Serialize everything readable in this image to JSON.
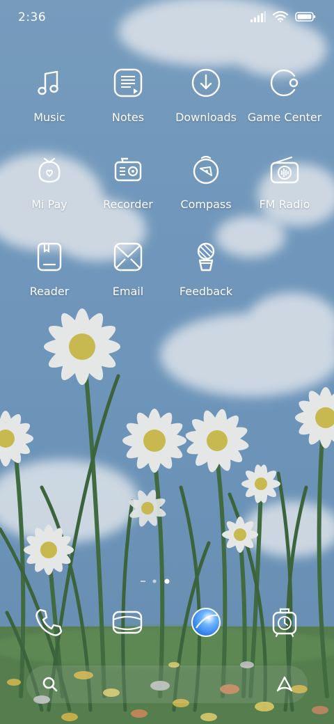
{
  "status_bar": {
    "time": "2:36"
  },
  "apps": [
    {
      "label": "Music",
      "icon": "music-icon"
    },
    {
      "label": "Notes",
      "icon": "notes-icon"
    },
    {
      "label": "Downloads",
      "icon": "downloads-icon"
    },
    {
      "label": "Game Center",
      "icon": "game-center-icon"
    },
    {
      "label": "Mi Pay",
      "icon": "mi-pay-icon"
    },
    {
      "label": "Recorder",
      "icon": "recorder-icon"
    },
    {
      "label": "Compass",
      "icon": "compass-icon"
    },
    {
      "label": "FM Radio",
      "icon": "fm-radio-icon"
    },
    {
      "label": "Reader",
      "icon": "reader-icon"
    },
    {
      "label": "Email",
      "icon": "email-icon"
    },
    {
      "label": "Feedback",
      "icon": "feedback-icon"
    }
  ],
  "page_indicator": {
    "pages": 3,
    "current": 3
  },
  "dock": [
    "phone-icon",
    "messages-icon",
    "browser-icon",
    "clock-icon"
  ],
  "search_bar": {
    "left_icon": "search-icon",
    "right_icon": "assistant-icon"
  },
  "colors": {
    "sky": "#6f98bd",
    "cloud": "#e8edf1",
    "grass": "#3f6b3a",
    "daisy_center": "#d7c44a"
  }
}
